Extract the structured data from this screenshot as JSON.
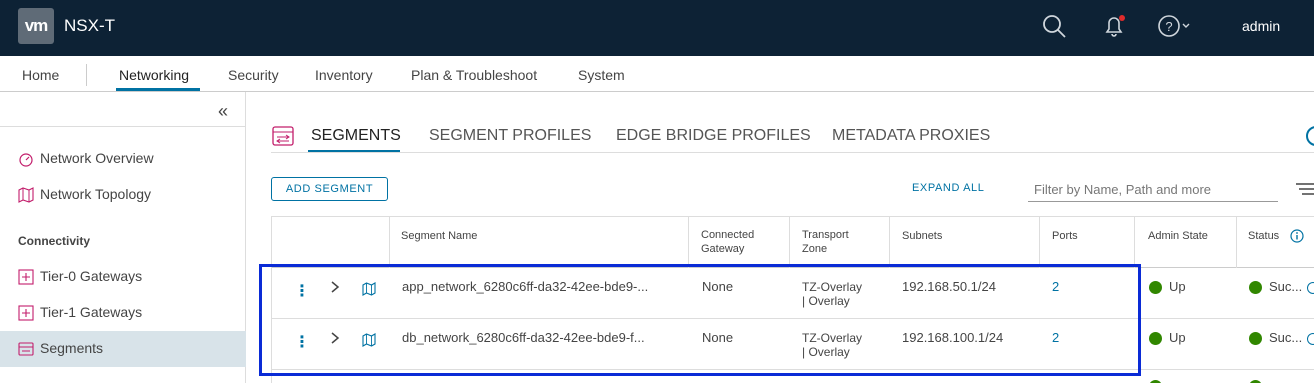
{
  "header": {
    "logo": "vm",
    "product": "NSX-T",
    "user": "admin",
    "icons": [
      "search-icon",
      "bell-icon",
      "help-icon"
    ],
    "colors": {
      "header_bg": "#0d2235",
      "accent": "#0072a3",
      "status_green": "#318700",
      "highlight_blue": "#0a2bd6"
    }
  },
  "nav": {
    "items": [
      "Home",
      "Networking",
      "Security",
      "Inventory",
      "Plan & Troubleshoot",
      "System"
    ],
    "active": "Networking"
  },
  "sidebar": {
    "collapse": "«",
    "items": [
      {
        "label": "Network Overview",
        "icon": "gauge-icon"
      },
      {
        "label": "Network Topology",
        "icon": "topology-icon"
      }
    ],
    "section": "Connectivity",
    "connectivity": [
      {
        "label": "Tier-0 Gateways",
        "icon": "router-icon"
      },
      {
        "label": "Tier-1 Gateways",
        "icon": "router-icon"
      },
      {
        "label": "Segments",
        "icon": "segment-icon",
        "active": true
      }
    ]
  },
  "tabs": [
    {
      "label": "SEGMENTS",
      "active": true
    },
    {
      "label": "SEGMENT PROFILES"
    },
    {
      "label": "EDGE BRIDGE PROFILES"
    },
    {
      "label": "METADATA PROXIES"
    }
  ],
  "toolbar": {
    "add_label": "ADD SEGMENT",
    "expand_label": "EXPAND ALL",
    "filter_placeholder": "Filter by Name, Path and more"
  },
  "table": {
    "columns": {
      "name": "Segment Name",
      "gateway": "Connected\nGateway",
      "tz": "Transport\nZone",
      "subnets": "Subnets",
      "ports": "Ports",
      "admin": "Admin State",
      "status": "Status"
    },
    "rows": [
      {
        "name": "app_network_6280c6ff-da32-42ee-bde9-...",
        "gateway": "None",
        "tz1": "TZ-Overlay",
        "tz2": "| Overlay",
        "subnet": "192.168.50.1/24",
        "ports": "2",
        "admin": "Up",
        "status": "Suc..."
      },
      {
        "name": "db_network_6280c6ff-da32-42ee-bde9-f...",
        "gateway": "None",
        "tz1": "TZ-Overlay",
        "tz2": "| Overlay",
        "subnet": "192.168.100.1/24",
        "ports": "2",
        "admin": "Up",
        "status": "Suc..."
      }
    ]
  }
}
